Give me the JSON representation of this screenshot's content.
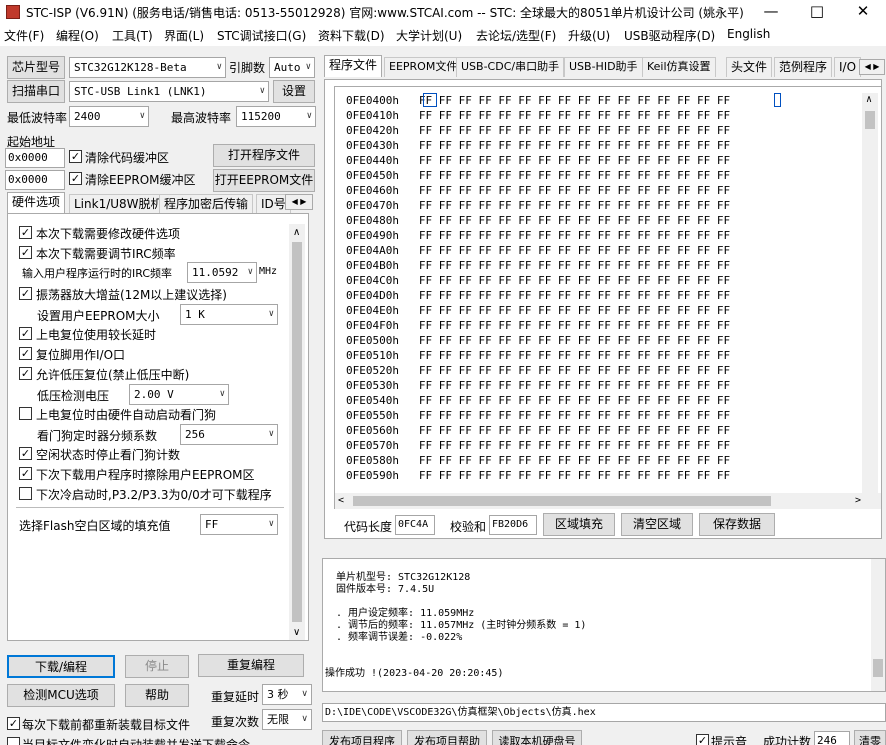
{
  "window": {
    "title": "STC-ISP (V6.91N) (服务电话/销售电话: 0513-55012928) 官网:www.STCAI.com  -- STC: 全球最大的8051单片机设计公司 (姚永平)",
    "minimize": "—",
    "maximize": "□",
    "close": "✕"
  },
  "menu": [
    "文件(F)",
    "编程(O)",
    "工具(T)",
    "界面(L)",
    "STC调试接口(G)",
    "资料下载(D)",
    "大学计划(U)",
    "去论坛/选型(F)",
    "升级(U)",
    "USB驱动程序(D)",
    "English"
  ],
  "left": {
    "chip_label": "芯片型号",
    "chip_value": "STC32G12K128-Beta",
    "pin_label": "引脚数",
    "pin_value": "Auto",
    "scan_btn": "扫描串口",
    "port_value": "STC-USB Link1 (LNK1)",
    "settings_btn": "设置",
    "min_baud_label": "最低波特率",
    "min_baud": "2400",
    "max_baud_label": "最高波特率",
    "max_baud": "115200",
    "start_addr_label": "起始地址",
    "addr1": "0x0000",
    "clear_code": "清除代码缓冲区",
    "open_prog": "打开程序文件",
    "addr2": "0x0000",
    "clear_eeprom": "清除EEPROM缓冲区",
    "open_eeprom": "打开EEPROM文件",
    "tabs": [
      "硬件选项",
      "Link1/U8W脱机",
      "程序加密后传输",
      "ID号"
    ],
    "options": {
      "o1": "本次下载需要修改硬件选项",
      "o2": "本次下载需要调节IRC频率",
      "irc_label": "输入用户程序运行时的IRC频率",
      "irc_value": "11.0592",
      "irc_unit": "MHz",
      "o3": "振荡器放大增益(12M以上建议选择)",
      "eeprom_label": "设置用户EEPROM大小",
      "eeprom_value": "1   K",
      "o4": "上电复位使用较长延时",
      "o5": "复位脚用作I/O口",
      "o6": "允许低压复位(禁止低压中断)",
      "lv_label": "低压检测电压",
      "lv_value": "2.00 V",
      "o7": "上电复位时由硬件自动启动看门狗",
      "wdt_label": "看门狗定时器分频系数",
      "wdt_value": "256",
      "o8": "空闲状态时停止看门狗计数",
      "o9": "下次下载用户程序时擦除用户EEPROM区",
      "o10": "下次冷启动时,P3.2/P3.3为0/0才可下载程序",
      "fill_label": "选择Flash空白区域的填充值",
      "fill_value": "FF"
    },
    "download_btn": "下载/编程",
    "stop_btn": "停止",
    "reprogram_btn": "重复编程",
    "detect_btn": "检测MCU选项",
    "help_btn": "帮助",
    "repeat_delay_label": "重复延时",
    "repeat_delay": "3 秒",
    "reload_label": "每次下载前都重新装载目标文件",
    "repeat_count_label": "重复次数",
    "repeat_count": "无限",
    "auto_label": "当目标文件变化时自动装载并发送下载命令"
  },
  "right": {
    "tabs": [
      "程序文件",
      "EEPROM文件",
      "USB-CDC/串口助手",
      "USB-HID助手",
      "Keil仿真设置",
      "头文件",
      "范例程序",
      "I/O"
    ],
    "hex_rows": [
      {
        "addr": "0FE0400h",
        "bytes": "FF FF FF FF FF FF FF FF FF FF FF FF FF FF FF FF"
      },
      {
        "addr": "0FE0410h",
        "bytes": "FF FF FF FF FF FF FF FF FF FF FF FF FF FF FF FF"
      },
      {
        "addr": "0FE0420h",
        "bytes": "FF FF FF FF FF FF FF FF FF FF FF FF FF FF FF FF"
      },
      {
        "addr": "0FE0430h",
        "bytes": "FF FF FF FF FF FF FF FF FF FF FF FF FF FF FF FF"
      },
      {
        "addr": "0FE0440h",
        "bytes": "FF FF FF FF FF FF FF FF FF FF FF FF FF FF FF FF"
      },
      {
        "addr": "0FE0450h",
        "bytes": "FF FF FF FF FF FF FF FF FF FF FF FF FF FF FF FF"
      },
      {
        "addr": "0FE0460h",
        "bytes": "FF FF FF FF FF FF FF FF FF FF FF FF FF FF FF FF"
      },
      {
        "addr": "0FE0470h",
        "bytes": "FF FF FF FF FF FF FF FF FF FF FF FF FF FF FF FF"
      },
      {
        "addr": "0FE0480h",
        "bytes": "FF FF FF FF FF FF FF FF FF FF FF FF FF FF FF FF"
      },
      {
        "addr": "0FE0490h",
        "bytes": "FF FF FF FF FF FF FF FF FF FF FF FF FF FF FF FF"
      },
      {
        "addr": "0FE04A0h",
        "bytes": "FF FF FF FF FF FF FF FF FF FF FF FF FF FF FF FF"
      },
      {
        "addr": "0FE04B0h",
        "bytes": "FF FF FF FF FF FF FF FF FF FF FF FF FF FF FF FF"
      },
      {
        "addr": "0FE04C0h",
        "bytes": "FF FF FF FF FF FF FF FF FF FF FF FF FF FF FF FF"
      },
      {
        "addr": "0FE04D0h",
        "bytes": "FF FF FF FF FF FF FF FF FF FF FF FF FF FF FF FF"
      },
      {
        "addr": "0FE04E0h",
        "bytes": "FF FF FF FF FF FF FF FF FF FF FF FF FF FF FF FF"
      },
      {
        "addr": "0FE04F0h",
        "bytes": "FF FF FF FF FF FF FF FF FF FF FF FF FF FF FF FF"
      },
      {
        "addr": "0FE0500h",
        "bytes": "FF FF FF FF FF FF FF FF FF FF FF FF FF FF FF FF"
      },
      {
        "addr": "0FE0510h",
        "bytes": "FF FF FF FF FF FF FF FF FF FF FF FF FF FF FF FF"
      },
      {
        "addr": "0FE0520h",
        "bytes": "FF FF FF FF FF FF FF FF FF FF FF FF FF FF FF FF"
      },
      {
        "addr": "0FE0530h",
        "bytes": "FF FF FF FF FF FF FF FF FF FF FF FF FF FF FF FF"
      },
      {
        "addr": "0FE0540h",
        "bytes": "FF FF FF FF FF FF FF FF FF FF FF FF FF FF FF FF"
      },
      {
        "addr": "0FE0550h",
        "bytes": "FF FF FF FF FF FF FF FF FF FF FF FF FF FF FF FF"
      },
      {
        "addr": "0FE0560h",
        "bytes": "FF FF FF FF FF FF FF FF FF FF FF FF FF FF FF FF"
      },
      {
        "addr": "0FE0570h",
        "bytes": "FF FF FF FF FF FF FF FF FF FF FF FF FF FF FF FF"
      },
      {
        "addr": "0FE0580h",
        "bytes": "FF FF FF FF FF FF FF FF FF FF FF FF FF FF FF FF"
      },
      {
        "addr": "0FE0590h",
        "bytes": "FF FF FF FF FF FF FF FF FF FF FF FF FF FF FF FF"
      }
    ],
    "code_len_label": "代码长度",
    "code_len": "0FC4A",
    "checksum_label": "校验和",
    "checksum": "FB20D6",
    "fill_btn": "区域填充",
    "clear_btn": "清空区域",
    "save_btn": "保存数据",
    "log": {
      "l1": "单片机型号: STC32G12K128",
      "l2": "固件版本号: 7.4.5U",
      "l3": ". 用户设定频率: 11.059MHz",
      "l4": ". 调节后的频率: 11.057MHz (主时钟分频系数 = 1)",
      "l5": ". 频率调节误差: -0.022%",
      "l6": "操作成功 !(2023-04-20 20:20:45)"
    },
    "path": "D:\\IDE\\CODE\\VSCODE32G\\仿真框架\\Objects\\仿真.hex",
    "pub_prog": "发布项目程序",
    "pub_help": "发布项目帮助",
    "read_disk": "读取本机硬盘号",
    "sound_label": "提示音",
    "count_label": "成功计数",
    "count_value": "246",
    "clear_label": "清零"
  }
}
